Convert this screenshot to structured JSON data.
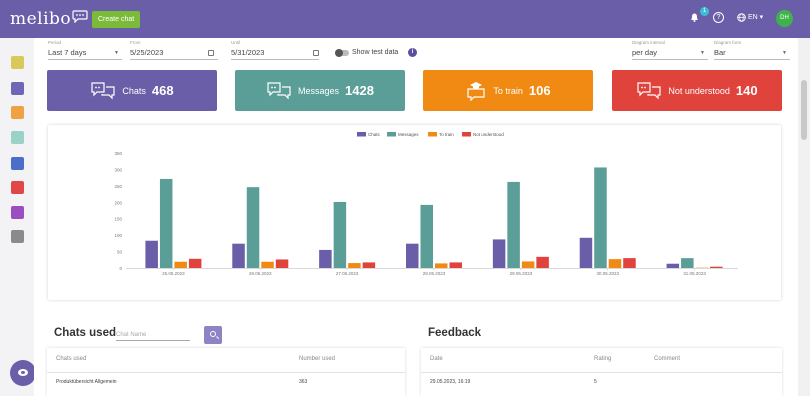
{
  "header": {
    "logo": "melibo",
    "create_chat": "Create chat",
    "notif_count": "1",
    "lang": "EN",
    "user_initials": "DH"
  },
  "filters": {
    "period_label": "Period",
    "period_value": "Last 7 days",
    "from_label": "From",
    "from_value": "5/25/2023",
    "until_label": "Until",
    "until_value": "5/31/2023",
    "show_test": "Show test data",
    "interval_label": "Diagram interval",
    "interval_value": "per day",
    "form_label": "Diagram form",
    "form_value": "Bar"
  },
  "cards": [
    {
      "label": "Chats",
      "value": "468",
      "color": "#6a5ea8"
    },
    {
      "label": "Messages",
      "value": "1428",
      "color": "#5b9d97"
    },
    {
      "label": "To train",
      "value": "106",
      "color": "#f08a13"
    },
    {
      "label": "Not understood",
      "value": "140",
      "color": "#e0423c"
    }
  ],
  "chart_data": {
    "type": "bar",
    "categories": [
      "25.05.2023",
      "26.05.2023",
      "27.05.2023",
      "28.05.2023",
      "29.05.2023",
      "30.05.2023",
      "31.05.2023"
    ],
    "series": [
      {
        "name": "Chats",
        "color": "#6a5ea8",
        "values": [
          83,
          74,
          55,
          74,
          87,
          92,
          13
        ]
      },
      {
        "name": "Messages",
        "color": "#5b9d97",
        "values": [
          271,
          246,
          201,
          192,
          262,
          306,
          30
        ]
      },
      {
        "name": "To train",
        "color": "#f08a13",
        "values": [
          19,
          19,
          15,
          14,
          20,
          27,
          1
        ]
      },
      {
        "name": "Not understood",
        "color": "#e0423c",
        "values": [
          28,
          26,
          17,
          17,
          34,
          30,
          4
        ]
      }
    ],
    "yticks": [
      "0",
      "50",
      "100",
      "150",
      "200",
      "250",
      "300",
      "350"
    ],
    "ylim": [
      0,
      350
    ],
    "legend": "top-center",
    "grid": false
  },
  "chats_used": {
    "title": "Chats used",
    "search_placeholder": "Chat Name",
    "col_chat": "Chats used",
    "col_number": "Number used",
    "row_name": "Produktübersicht Allgemein",
    "row_number": "363"
  },
  "feedback": {
    "title": "Feedback",
    "col_date": "Date",
    "col_rating": "Rating",
    "col_comment": "Comment",
    "row_date": "29.05.2023, 16:19",
    "row_rating": "5"
  },
  "sidebar_colors": [
    "#d9c85a",
    "#6f66b8",
    "#f0a243",
    "#9ad1c8",
    "#4a6fc9",
    "#e04848",
    "#9a4fc0",
    "#8a8a8a"
  ]
}
